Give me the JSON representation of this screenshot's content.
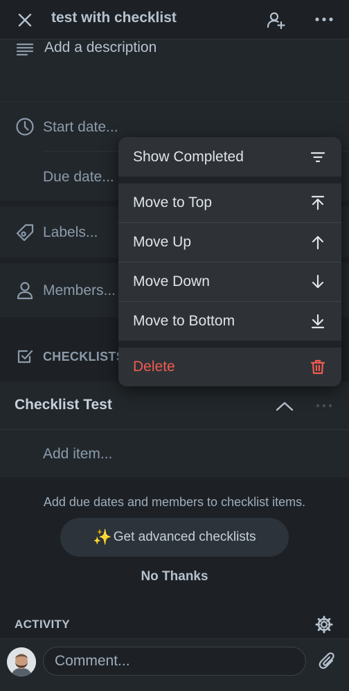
{
  "header": {
    "title": "test with checklist"
  },
  "description": {
    "placeholder": "Add a description"
  },
  "dates": {
    "start": "Start date...",
    "due": "Due date..."
  },
  "labels": {
    "placeholder": "Labels..."
  },
  "members": {
    "placeholder": "Members..."
  },
  "checklists": {
    "section_label": "CHECKLISTS"
  },
  "checklist": {
    "title": "Checklist Test",
    "add_item": "Add item..."
  },
  "promo": {
    "message": "Add due dates and members to checklist items.",
    "cta_emoji": "✨",
    "cta_label": "Get advanced checklists",
    "dismiss_label": "No Thanks"
  },
  "activity": {
    "label": "ACTIVITY"
  },
  "composer": {
    "placeholder": "Comment..."
  },
  "menu": {
    "show_completed": "Show Completed",
    "move_top": "Move to Top",
    "move_up": "Move Up",
    "move_down": "Move Down",
    "move_bottom": "Move to Bottom",
    "delete": "Delete"
  },
  "colors": {
    "danger": "#f15b50",
    "background": "#1d2125",
    "panel": "#22272b",
    "menu": "#2e3236"
  }
}
